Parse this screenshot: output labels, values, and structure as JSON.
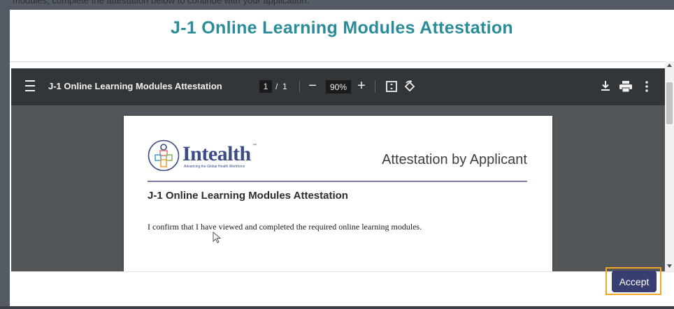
{
  "background": {
    "partial_text": "modules, complete the attestation below to continue with your application."
  },
  "modal": {
    "title": "J-1 Online Learning Modules Attestation",
    "accept_label": "Accept",
    "accent_color": "#2a8b99",
    "button_color": "#383d72",
    "focus_ring_color": "#f0a624"
  },
  "viewer": {
    "toolbar": {
      "doc_title": "J-1 Online Learning Modules Attestation",
      "current_page": "1",
      "page_separator": "/",
      "total_pages": "1",
      "zoom": "90%",
      "zoom_out": "−",
      "zoom_in": "+",
      "icons": [
        "menu-icon",
        "fit-page-icon",
        "rotate-icon",
        "download-icon",
        "print-icon",
        "more-options-icon"
      ]
    },
    "document": {
      "logo_text": "Intealth",
      "logo_tm": "™",
      "logo_tagline": "Advancing the Global Health Workforce",
      "header_right": "Attestation by Applicant",
      "heading": "J-1 Online Learning Modules Attestation",
      "body": "I confirm that I have viewed and completed the required online learning modules."
    }
  }
}
